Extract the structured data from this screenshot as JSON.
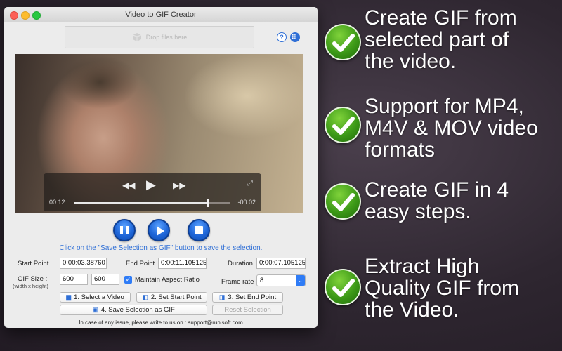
{
  "window": {
    "title": "Video to GIF Creator",
    "drop_text": "Drop files here",
    "help_label": "?"
  },
  "video": {
    "elapsed": "00:12",
    "remaining": "-00:02",
    "progress": 0.85
  },
  "hint": "Click on the \"Save Selection as GIF\" button to save the selection.",
  "form": {
    "start_label": "Start Point",
    "start_value": "0:00:03.38760",
    "end_label": "End Point",
    "end_value": "0:00:11.105125",
    "duration_label": "Duration",
    "duration_value": "0:00:07.105125",
    "gif_size_label": "GIF Size :",
    "gif_size_sublabel": "(width x height)",
    "width_value": "600",
    "height_value": "600",
    "aspect_label": "Maintain Aspect Ratio",
    "aspect_checked": true,
    "frame_rate_label": "Frame rate",
    "frame_rate_value": "8"
  },
  "buttons": {
    "select_video": "1. Select a Video",
    "set_start": "2. Set Start Point",
    "set_end": "3. Set End Point",
    "save_gif": "4. Save Selection as GIF",
    "reset": "Reset Selection"
  },
  "footer": "In case of any issue, please write to us on : support@runisoft.com",
  "features": [
    {
      "lines": [
        "Create GIF from",
        "selected part of",
        "the video."
      ]
    },
    {
      "lines": [
        "Support for MP4,",
        "M4V & MOV video",
        "formats"
      ]
    },
    {
      "lines": [
        "Create GIF in 4",
        "easy steps."
      ]
    },
    {
      "lines": [
        "Extract High",
        "Quality GIF from",
        "the Video."
      ]
    }
  ],
  "colors": {
    "accent": "#2f6fd6",
    "check_green": "#3d9a18",
    "background": "#2e2630"
  }
}
